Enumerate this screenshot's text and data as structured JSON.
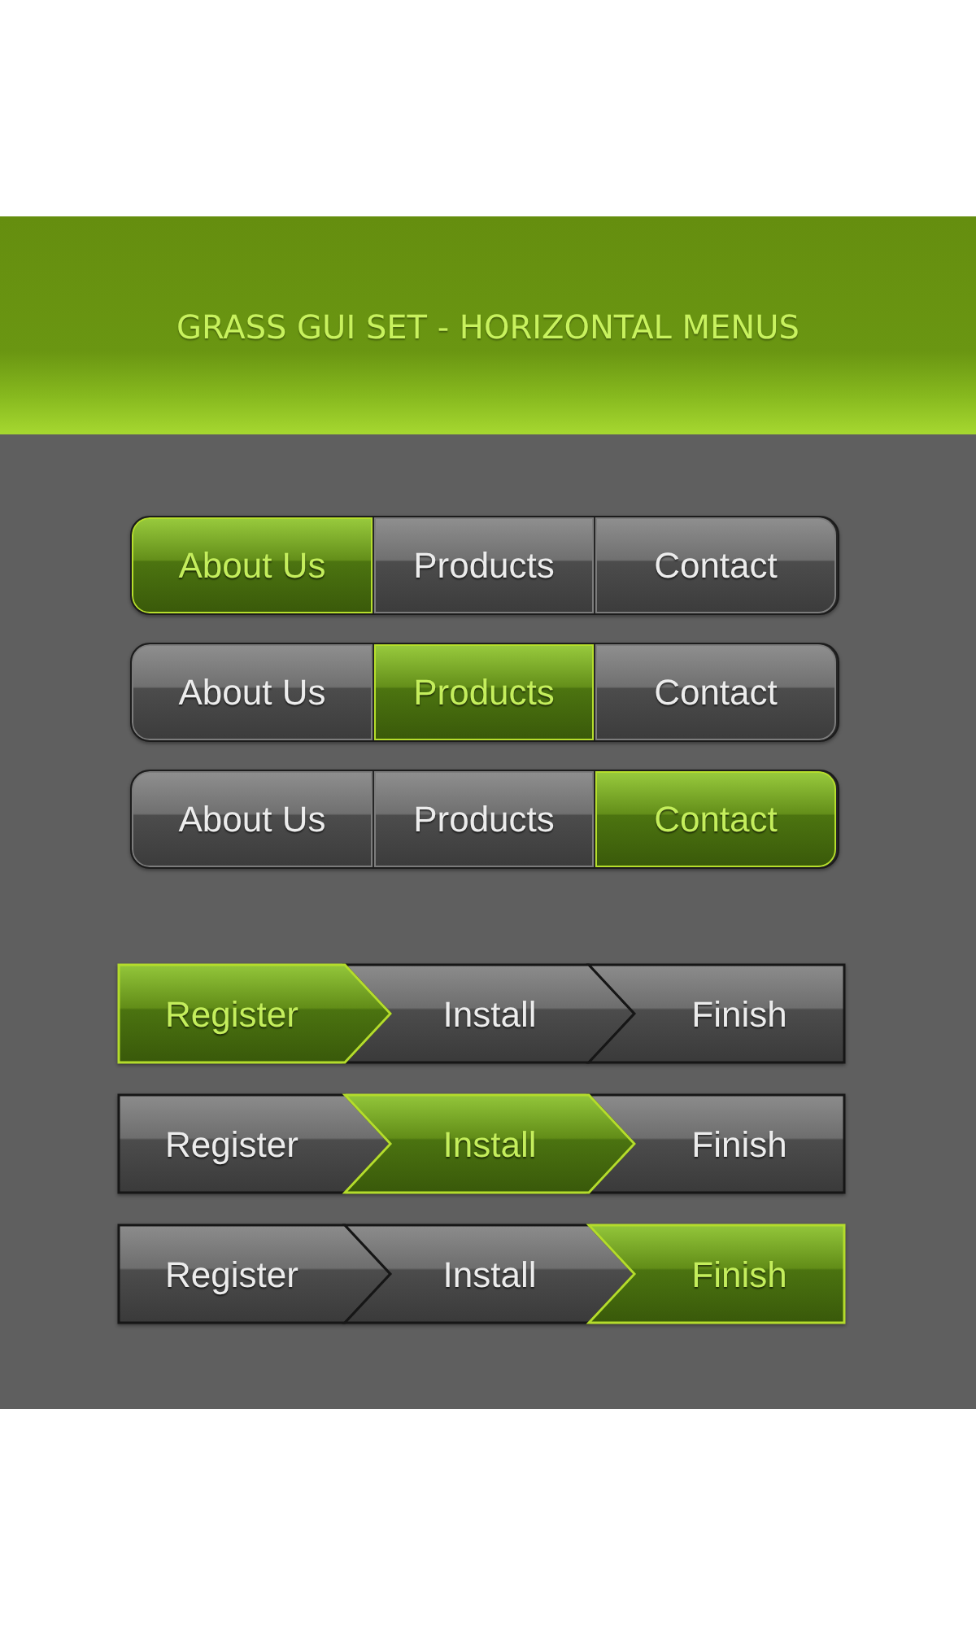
{
  "header": {
    "title": "GRASS GUI SET - HORIZONTAL MENUS"
  },
  "tab_menus": [
    {
      "items": [
        {
          "label": "About Us",
          "selected": true
        },
        {
          "label": "Products",
          "selected": false
        },
        {
          "label": "Contact",
          "selected": false
        }
      ]
    },
    {
      "items": [
        {
          "label": "About Us",
          "selected": false
        },
        {
          "label": "Products",
          "selected": true
        },
        {
          "label": "Contact",
          "selected": false
        }
      ]
    },
    {
      "items": [
        {
          "label": "About Us",
          "selected": false
        },
        {
          "label": "Products",
          "selected": false
        },
        {
          "label": "Contact",
          "selected": true
        }
      ]
    }
  ],
  "step_menus": [
    {
      "steps": [
        {
          "label": "Register",
          "selected": true
        },
        {
          "label": "Install",
          "selected": false
        },
        {
          "label": "Finish",
          "selected": false
        }
      ]
    },
    {
      "steps": [
        {
          "label": "Register",
          "selected": false
        },
        {
          "label": "Install",
          "selected": true
        },
        {
          "label": "Finish",
          "selected": false
        }
      ]
    },
    {
      "steps": [
        {
          "label": "Register",
          "selected": false
        },
        {
          "label": "Install",
          "selected": false
        },
        {
          "label": "Finish",
          "selected": true
        }
      ]
    }
  ]
}
